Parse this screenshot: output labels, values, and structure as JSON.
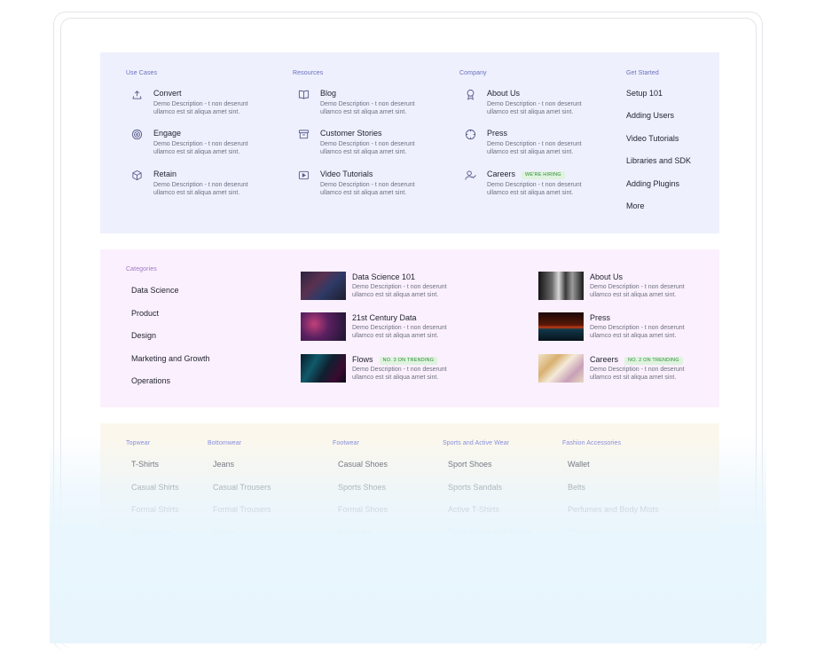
{
  "panel1": {
    "columns": [
      {
        "title": "Use Cases",
        "items": [
          {
            "icon": "convert-icon",
            "title": "Convert",
            "desc": "Demo Description - t non deserunt ullamco est sit aliqua amet sint."
          },
          {
            "icon": "target-icon",
            "title": "Engage",
            "desc": "Demo Description - t non deserunt ullamco est sit aliqua amet sint."
          },
          {
            "icon": "cube-icon",
            "title": "Retain",
            "desc": "Demo Description - t non deserunt ullamco est sit aliqua amet sint."
          }
        ]
      },
      {
        "title": "Resources",
        "items": [
          {
            "icon": "book-icon",
            "title": "Blog",
            "desc": "Demo Description - t non deserunt ullamco est sit aliqua amet sint."
          },
          {
            "icon": "archive-icon",
            "title": "Customer Stories",
            "desc": "Demo Description - t non deserunt ullamco est sit aliqua amet sint."
          },
          {
            "icon": "video-icon",
            "title": "Video Tutorials",
            "desc": "Demo Description - t non deserunt ullamco est sit aliqua amet sint."
          }
        ]
      },
      {
        "title": "Company",
        "items": [
          {
            "icon": "award-icon",
            "title": "About Us",
            "desc": "Demo Description - t non deserunt ullamco est sit aliqua amet sint."
          },
          {
            "icon": "compass-icon",
            "title": "Press",
            "desc": "Demo Description - t non deserunt ullamco est sit aliqua amet sint."
          },
          {
            "icon": "user-check-icon",
            "title": "Careers",
            "badge": "WE'RE HIRING",
            "desc": "Demo Description - t non deserunt ullamco est sit aliqua amet sint."
          }
        ]
      }
    ],
    "get_started": {
      "title": "Get Started",
      "links": [
        "Setup 101",
        "Adding Users",
        "Video Tutorials",
        "Libraries and SDK",
        "Adding Plugins",
        "More"
      ]
    }
  },
  "panel2": {
    "categories": {
      "title": "Categories",
      "links": [
        "Data Science",
        "Product",
        "Design",
        "Marketing and Growth",
        "Operations"
      ]
    },
    "cards_left": [
      {
        "title": "Data Science 101",
        "desc": "Demo Description - t non deserunt ullamco est sit aliqua amet sint."
      },
      {
        "title": "21st Century Data",
        "desc": "Demo Description - t non deserunt ullamco est sit aliqua amet sint."
      },
      {
        "title": "Flows",
        "badge": "NO. 3 ON TRENDING",
        "desc": "Demo Description - t non deserunt ullamco est sit aliqua amet sint."
      }
    ],
    "cards_right": [
      {
        "title": "About Us",
        "desc": "Demo Description - t non deserunt ullamco est sit aliqua amet sint."
      },
      {
        "title": "Press",
        "desc": "Demo Description - t non deserunt ullamco est sit aliqua amet sint."
      },
      {
        "title": "Careers",
        "badge": "NO. 2 ON TRENDING",
        "desc": "Demo Description - t non deserunt ullamco est sit aliqua amet sint."
      }
    ]
  },
  "panel3": {
    "columns": [
      {
        "title": "Topwear",
        "links": [
          "T-Shirts",
          "Casual Shirts",
          "Formal Shirts",
          "Sweatshirts"
        ]
      },
      {
        "title": "Bottomwear",
        "links": [
          "Jeans",
          "Casual Trousers",
          "Formal Trousers",
          "Shorts"
        ]
      },
      {
        "title": "Footwear",
        "links": [
          "Casual Shoes",
          "Sports Shoes",
          "Formal Shoes",
          "Sneakers"
        ]
      },
      {
        "title": "Sports and Active Wear",
        "links": [
          "Sport Shoes",
          "Sports Sandals",
          "Active T-Shirts",
          "Track Pants and Shorts"
        ]
      },
      {
        "title": "Fashion Accessories",
        "links": [
          "Wallet",
          "Belts",
          "Perfumes and Body Mists",
          "Trimmers"
        ]
      }
    ]
  },
  "colors": {
    "panel1_bg": "#eef0fd",
    "panel2_bg": "#fbf0fd",
    "panel3_bg": "#fcf7ec",
    "fade_bg": "#e8f5fd",
    "badge_bg": "#dff3df",
    "badge_text": "#2f8a3a"
  }
}
